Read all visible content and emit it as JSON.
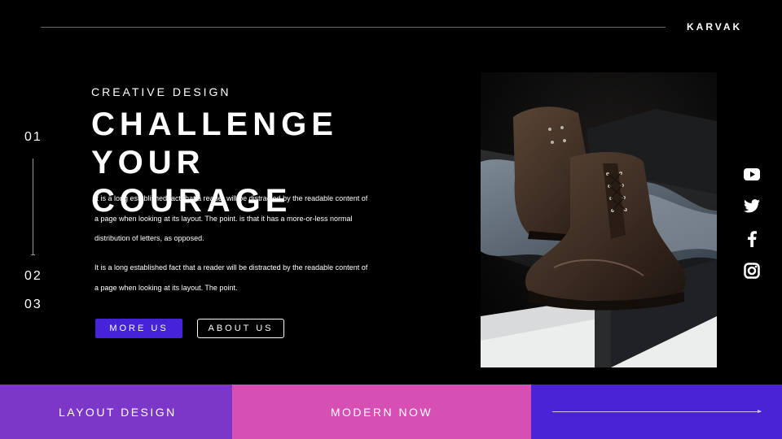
{
  "header": {
    "brand": "KARVAK"
  },
  "side_numbers": [
    "01",
    "02",
    "03"
  ],
  "hero": {
    "kicker": "CREATIVE DESIGN",
    "headline_lines": [
      "CHALLENGE",
      "YOUR",
      "COURAGE"
    ],
    "paragraph_1": "It is a long established fact that a reader will be distracted by the readable content of a page when looking at its layout. The point. is that it has a more-or-less normal distribution of letters, as opposed.",
    "paragraph_2": "It is a long established fact that a reader will be distracted by the readable content of a page when looking at its layout. The point."
  },
  "buttons": {
    "more": "MORE US",
    "about": "ABOUT US"
  },
  "social_icons": [
    "youtube-icon",
    "twitter-icon",
    "facebook-icon",
    "instagram-icon"
  ],
  "footer": {
    "left": "LAYOUT DESIGN",
    "center": "MODERN NOW"
  },
  "colors": {
    "background": "#000000",
    "accent_blue": "#4423d9",
    "footer_purple": "#7c37c9",
    "footer_pink": "#d64fb3",
    "footer_indigo": "#4a23d4"
  }
}
